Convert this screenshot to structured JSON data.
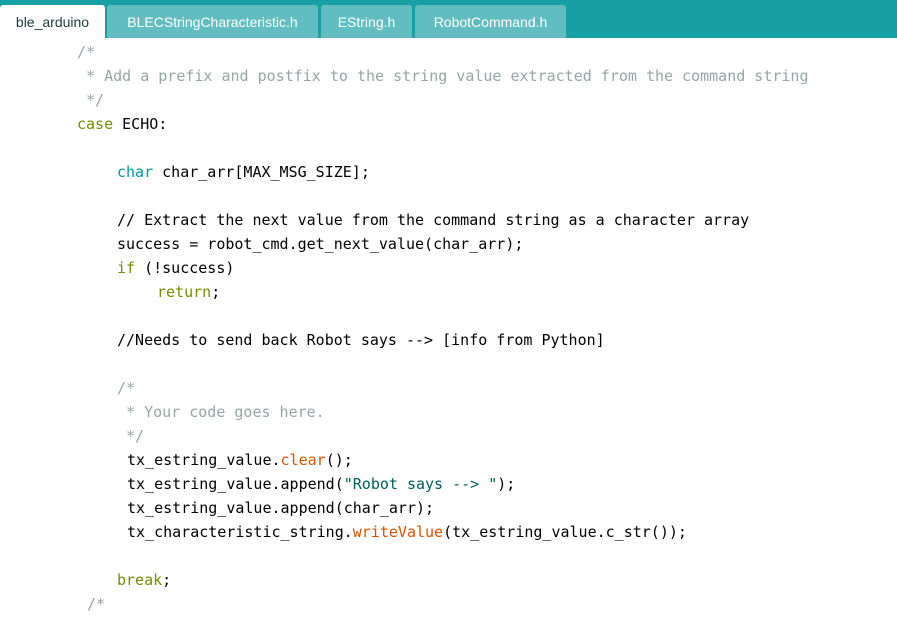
{
  "tabs": [
    {
      "label": "ble_arduino",
      "active": true
    },
    {
      "label": "BLECStringCharacteristic.h",
      "active": false
    },
    {
      "label": "EString.h",
      "active": false
    },
    {
      "label": "RobotCommand.h",
      "active": false
    }
  ],
  "colors": {
    "tabbar": "#17a1a5",
    "tab_inactive": "#62bdc0",
    "keyword": "#728e00",
    "type": "#00979c",
    "function": "#d35400",
    "string": "#005c5f",
    "comment": "#95a5a6"
  },
  "code": {
    "lines": [
      {
        "indent": 8,
        "parts": [
          {
            "c": "com",
            "t": "/*"
          }
        ]
      },
      {
        "indent": 8,
        "parts": [
          {
            "c": "com",
            "t": " * Add a prefix and postfix to the string value extracted from the command string"
          }
        ]
      },
      {
        "indent": 8,
        "parts": [
          {
            "c": "com",
            "t": " */"
          }
        ]
      },
      {
        "indent": 8,
        "parts": [
          {
            "c": "kw",
            "t": "case"
          },
          {
            "c": "tx",
            "t": " ECHO:"
          }
        ]
      },
      {
        "indent": 0,
        "parts": []
      },
      {
        "indent": 12,
        "parts": [
          {
            "c": "ty",
            "t": "char"
          },
          {
            "c": "tx",
            "t": " char_arr[MAX_MSG_SIZE];"
          }
        ]
      },
      {
        "indent": 0,
        "parts": []
      },
      {
        "indent": 12,
        "parts": [
          {
            "c": "tx",
            "t": "// Extract the next value from the command string as a character array"
          }
        ]
      },
      {
        "indent": 12,
        "parts": [
          {
            "c": "tx",
            "t": "success = robot_cmd.get_next_value(char_arr);"
          }
        ]
      },
      {
        "indent": 12,
        "parts": [
          {
            "c": "kw",
            "t": "if"
          },
          {
            "c": "tx",
            "t": " (!success)"
          }
        ]
      },
      {
        "indent": 16,
        "parts": [
          {
            "c": "kw",
            "t": "return"
          },
          {
            "c": "tx",
            "t": ";"
          }
        ]
      },
      {
        "indent": 0,
        "parts": []
      },
      {
        "indent": 12,
        "parts": [
          {
            "c": "tx",
            "t": "//Needs to send back Robot says --> [info from Python]"
          }
        ]
      },
      {
        "indent": 0,
        "parts": []
      },
      {
        "indent": 12,
        "parts": [
          {
            "c": "com",
            "t": "/*"
          }
        ]
      },
      {
        "indent": 12,
        "parts": [
          {
            "c": "com",
            "t": " * Your code goes here."
          }
        ]
      },
      {
        "indent": 12,
        "parts": [
          {
            "c": "com",
            "t": " */"
          }
        ]
      },
      {
        "indent": 13,
        "parts": [
          {
            "c": "tx",
            "t": "tx_estring_value."
          },
          {
            "c": "fn",
            "t": "clear"
          },
          {
            "c": "tx",
            "t": "();"
          }
        ]
      },
      {
        "indent": 13,
        "parts": [
          {
            "c": "tx",
            "t": "tx_estring_value.append("
          },
          {
            "c": "str",
            "t": "\"Robot says --> \""
          },
          {
            "c": "tx",
            "t": ");"
          }
        ]
      },
      {
        "indent": 13,
        "parts": [
          {
            "c": "tx",
            "t": "tx_estring_value.append(char_arr);"
          }
        ]
      },
      {
        "indent": 13,
        "parts": [
          {
            "c": "tx",
            "t": "tx_characteristic_string."
          },
          {
            "c": "fn",
            "t": "writeValue"
          },
          {
            "c": "tx",
            "t": "(tx_estring_value.c_str());"
          }
        ]
      },
      {
        "indent": 0,
        "parts": []
      },
      {
        "indent": 12,
        "parts": [
          {
            "c": "kw",
            "t": "break"
          },
          {
            "c": "tx",
            "t": ";"
          }
        ]
      },
      {
        "indent": 9,
        "parts": [
          {
            "c": "com",
            "t": "/*"
          }
        ]
      }
    ]
  }
}
